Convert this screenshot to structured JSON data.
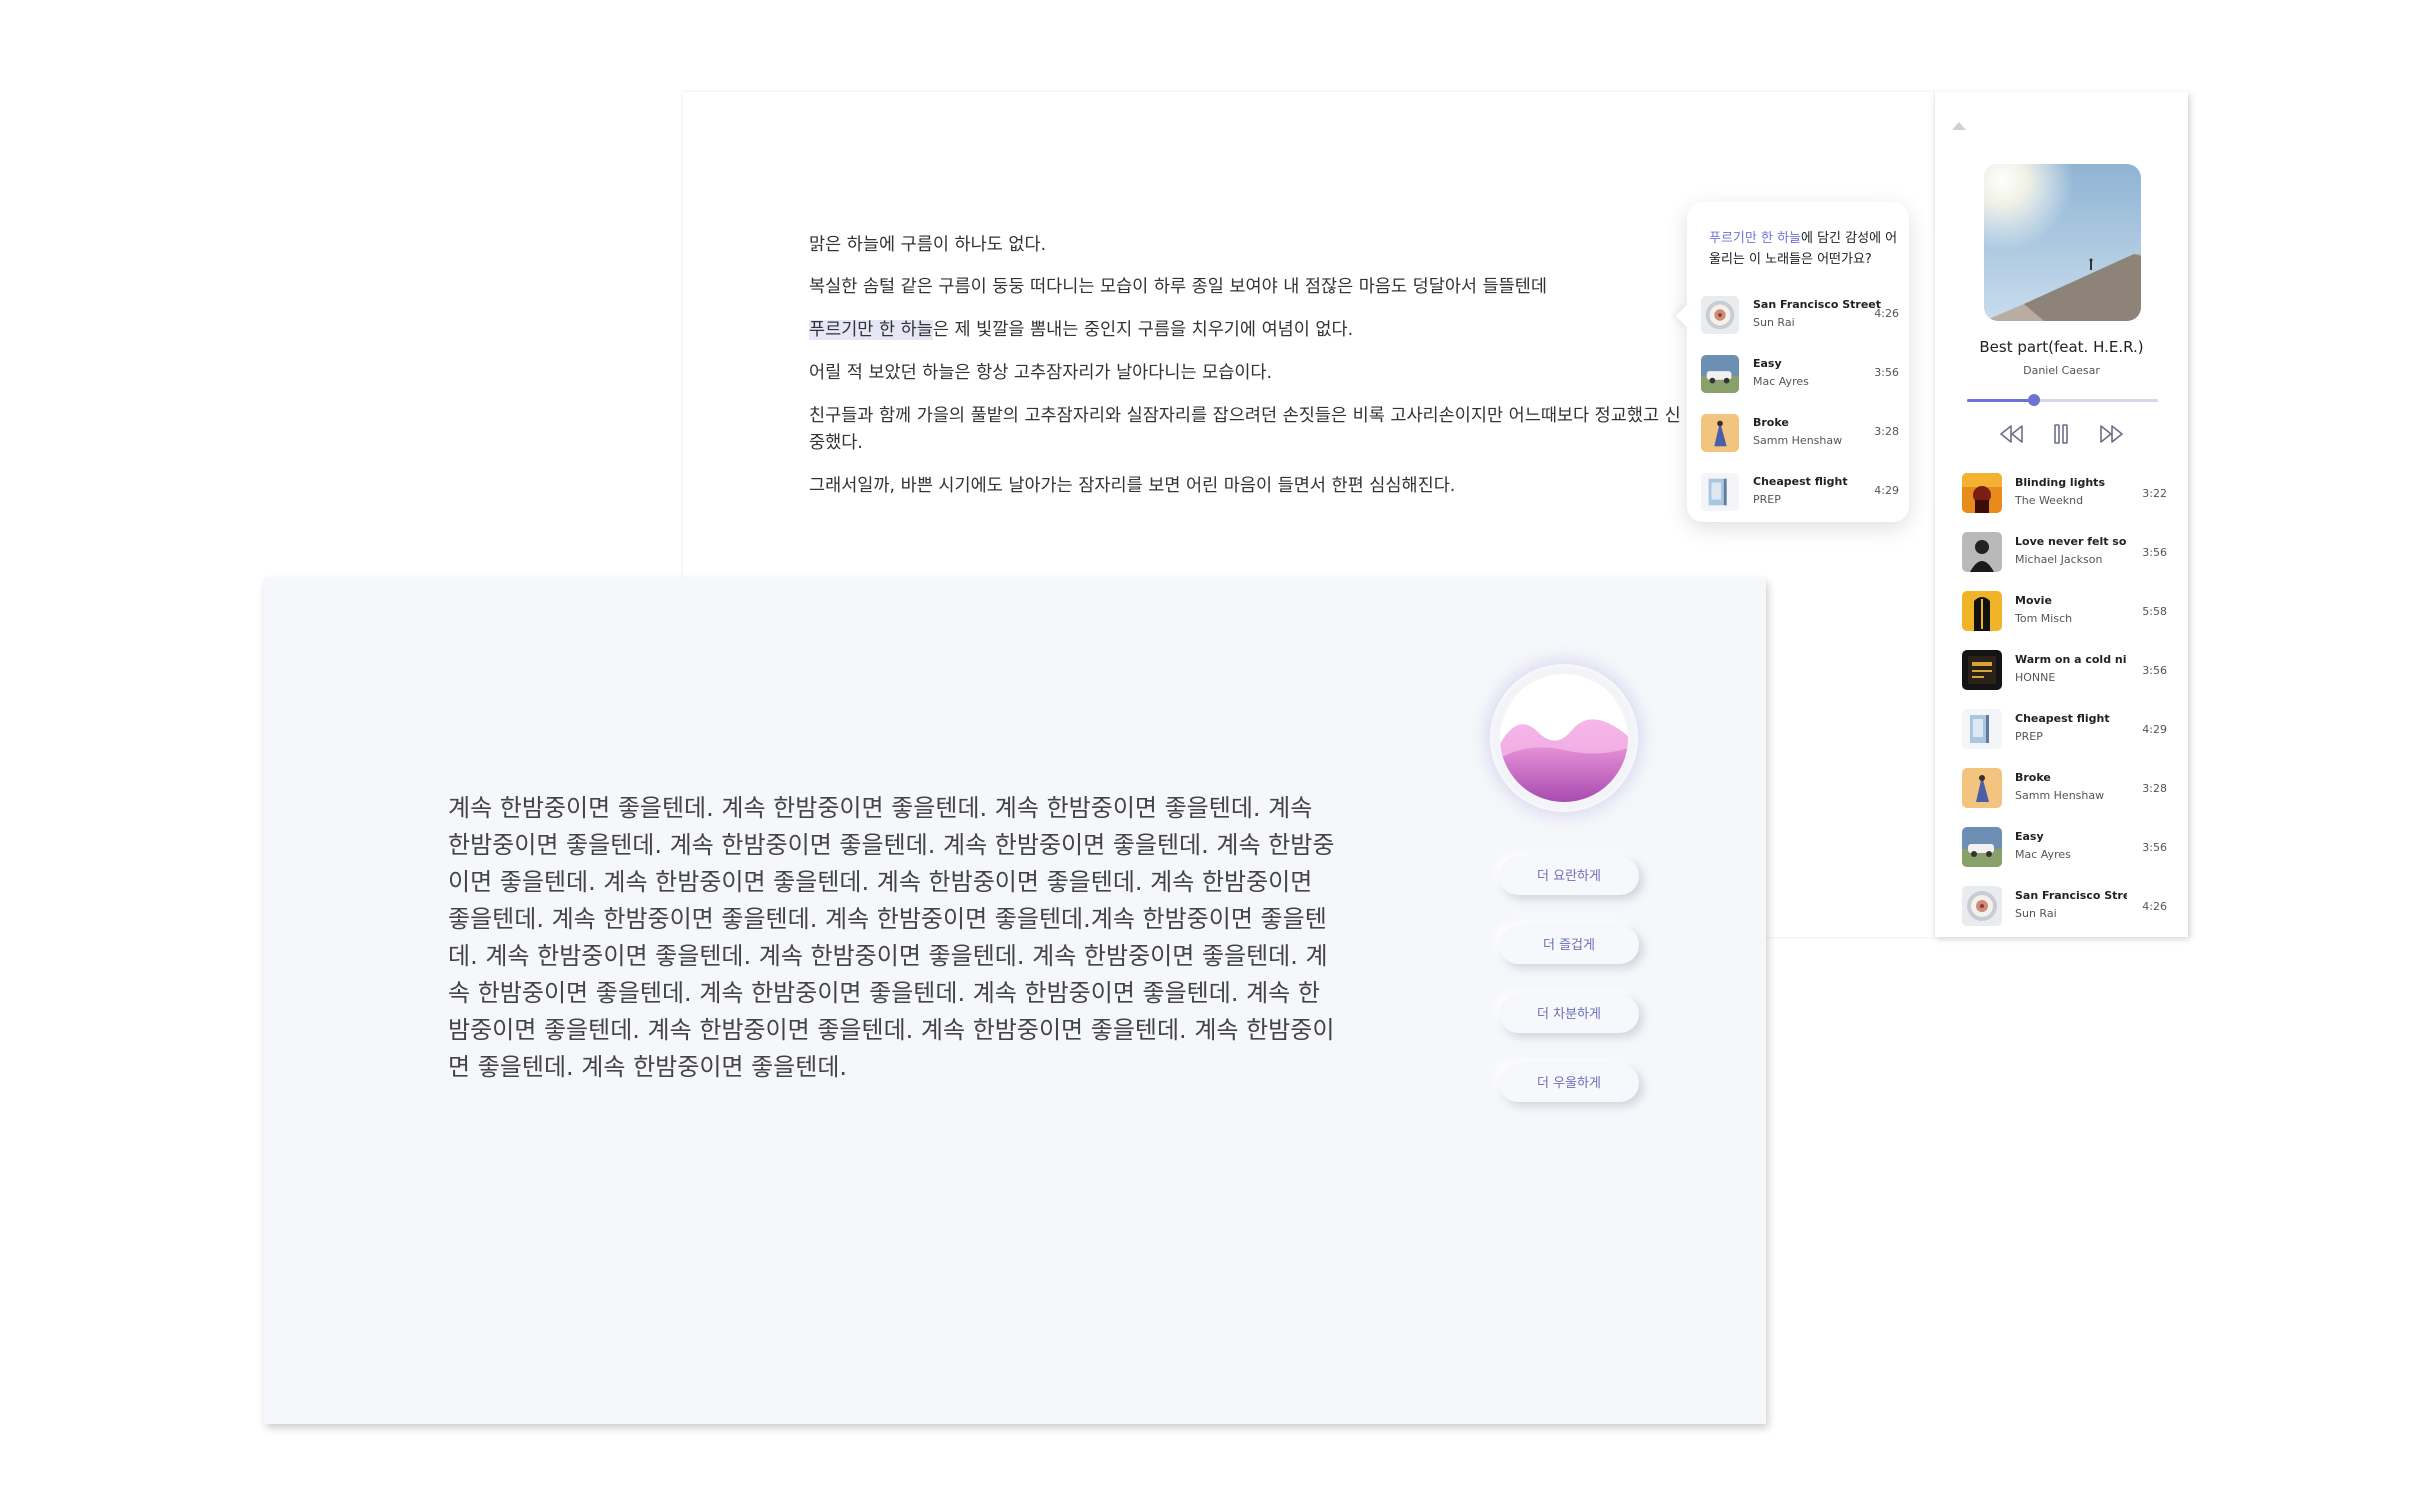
{
  "document": {
    "paragraphs": [
      "맑은 하늘에 구름이 하나도 없다.",
      "복실한 솜털 같은 구름이 둥둥 떠다니는 모습이 하루 종일 보여야 내 점잖은 마음도 덩달아서 들뜰텐데",
      "어릴 적 보았던 하늘은 항상 고추잠자리가 날아다니는 모습이다.",
      "친구들과 함께 가을의 풀밭의 고추잠자리와 실잠자리를 잡으려던 손짓들은 비록 고사리손이지만 어느때보다 정교했고 신중했다.",
      "그래서일까, 바쁜 시기에도 날아가는 잠자리를 보면 어린 마음이 들면서 한편 심심해진다."
    ],
    "highlight_text": "푸르기만 한 하늘",
    "highlight_rest": "은 제 빛깔을 뽐내는 중인지 구름을 치우기에 여념이 없다."
  },
  "recommend": {
    "header_accent": "푸르기만 한 하늘",
    "header_rest": "에 담긴 감성에 어울리는 이 노래들은 어떤가요?",
    "songs": [
      {
        "title": "San Francisco Street",
        "artist": "Sun Rai",
        "duration": "4:26",
        "art": "sf"
      },
      {
        "title": "Easy",
        "artist": "Mac Ayres",
        "duration": "3:56",
        "art": "easy"
      },
      {
        "title": "Broke",
        "artist": "Samm Henshaw",
        "duration": "3:28",
        "art": "broke"
      },
      {
        "title": "Cheapest flight",
        "artist": "PREP",
        "duration": "4:29",
        "art": "cheapest"
      }
    ]
  },
  "player": {
    "now_playing": {
      "title": "Best part(feat. H.E.R.)",
      "artist": "Daniel Caesar"
    },
    "progress": 0.35,
    "controls": {
      "rewind": "rewind-icon",
      "pause": "pause-icon",
      "forward": "fast-forward-icon"
    },
    "playlist": [
      {
        "title": "Blinding lights",
        "artist": "The Weeknd",
        "duration": "3:22",
        "art": "blinding"
      },
      {
        "title": "Love never felt so...",
        "artist": "Michael Jackson",
        "duration": "3:56",
        "art": "mj"
      },
      {
        "title": "Movie",
        "artist": "Tom Misch",
        "duration": "5:58",
        "art": "movie"
      },
      {
        "title": "Warm on a cold night",
        "artist": "HONNE",
        "duration": "3:56",
        "art": "honne"
      },
      {
        "title": "Cheapest flight",
        "artist": "PREP",
        "duration": "4:29",
        "art": "cheapest"
      },
      {
        "title": "Broke",
        "artist": "Samm Henshaw",
        "duration": "3:28",
        "art": "broke"
      },
      {
        "title": "Easy",
        "artist": "Mac Ayres",
        "duration": "3:56",
        "art": "easy"
      },
      {
        "title": "San Francisco Street",
        "artist": "Sun Rai",
        "duration": "4:26",
        "art": "sf"
      }
    ]
  },
  "writer": {
    "text": "계속 한밤중이면 좋을텐데. 계속 한밤중이면 좋을텐데. 계속 한밤중이면 좋을텐데. 계속 한밤중이면 좋을텐데. 계속 한밤중이면 좋을텐데. 계속 한밤중이면 좋을텐데. 계속 한밤중이면 좋을텐데. 계속 한밤중이면 좋을텐데. 계속 한밤중이면 좋을텐데. 계속 한밤중이면 좋을텐데. 계속 한밤중이면 좋을텐데. 계속 한밤중이면 좋을텐데.계속 한밤중이면 좋을텐데. 계속 한밤중이면 좋을텐데. 계속 한밤중이면 좋을텐데. 계속 한밤중이면 좋을텐데. 계속 한밤중이면 좋을텐데. 계속 한밤중이면 좋을텐데. 계속 한밤중이면 좋을텐데. 계속 한밤중이면 좋을텐데. 계속 한밤중이면 좋을텐데. 계속 한밤중이면 좋을텐데. 계속 한밤중이면 좋을텐데. 계속 한밤중이면 좋을텐데.",
    "tone_buttons": [
      "더 요란하게",
      "더 즐겁게",
      "더 차분하게",
      "더 우울하게"
    ]
  },
  "colors": {
    "accent": "#6d72d6",
    "highlight": "#e6e7f6",
    "orb_pink": "#c45fbf"
  }
}
